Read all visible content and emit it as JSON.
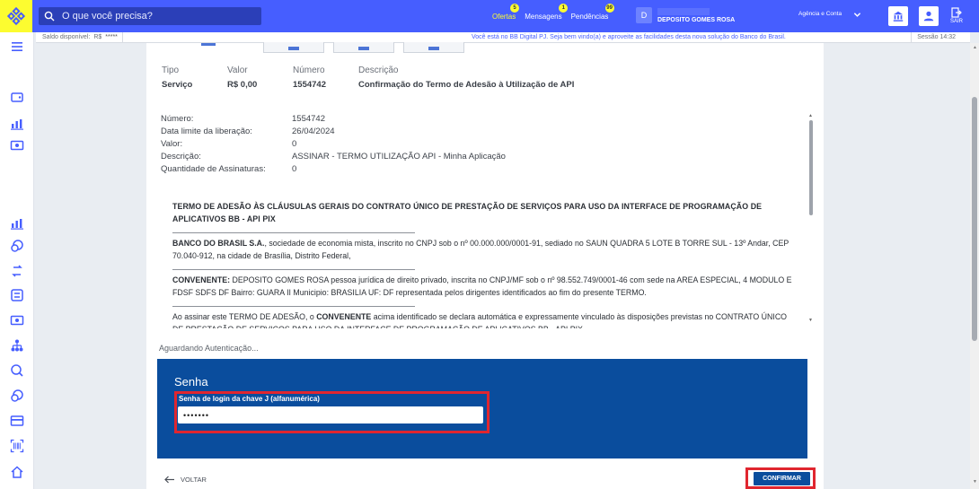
{
  "topbar": {
    "search_placeholder": "O que você precisa?",
    "nav": [
      {
        "label": "Ofertas",
        "badge": "5"
      },
      {
        "label": "Mensagens",
        "badge": "1"
      },
      {
        "label": "Pendências",
        "badge": "99"
      }
    ],
    "avatar_initial": "D",
    "company_name": "DEPOSITO GOMES ROSA",
    "agency_label": "Agência e Conta",
    "logout_label": "SAIR"
  },
  "infobar": {
    "balance_label": "Saldo disponível:",
    "balance_currency": "R$",
    "balance_value": "*****",
    "welcome": "Você está no BB Digital PJ. Seja bem vindo(a) e aproveite as facilidades desta nova solução do Banco do Brasil.",
    "session": "Sessão 14:32"
  },
  "summary": {
    "headers": [
      "Tipo",
      "Valor",
      "Número",
      "Descrição"
    ],
    "values": [
      "Serviço",
      "R$ 0,00",
      "1554742",
      "Confirmação do Termo de Adesão à Utilização de API"
    ]
  },
  "details": [
    {
      "label": "Número:",
      "value": "1554742"
    },
    {
      "label": "Data limite da liberação:",
      "value": "26/04/2024"
    },
    {
      "label": "Valor:",
      "value": "0"
    },
    {
      "label": "Descrição:",
      "value": "ASSINAR - TERMO UTILIZAÇÃO API - Minha Aplicação"
    },
    {
      "label": "Quantidade de Assinaturas:",
      "value": "0"
    }
  ],
  "term": {
    "title": "TERMO DE ADESÃO ÀS CLÁUSULAS GERAIS DO CONTRATO ÚNICO DE PRESTAÇÃO DE SERVIÇOS PARA USO DA INTERFACE DE PROGRAMAÇÃO DE APLICATIVOS BB - API PIX",
    "bank_name": "BANCO DO BRASIL S.A.",
    "bank_text": ", sociedade de economia mista, inscrito no CNPJ sob o nº 00.000.000/0001-91, sediado no SAUN QUADRA 5 LOTE B TORRE SUL - 13º Andar, CEP 70.040-912, na cidade de Brasília, Distrito Federal,",
    "conv_label": "CONVENENTE:",
    "conv_text": " DEPOSITO GOMES ROSA pessoa jurídica de direito privado, inscrita no CNPJ/MF sob o nº 98.552.749/0001-46 com sede na AREA ESPECIAL, 4 MODULO E FDSF SDFS DF Bairro: GUARA II Municipio: BRASILIA UF: DF representada pelos dirigentes identificados ao fim do presente TERMO.",
    "adhesion_pre": "Ao assinar este TERMO DE ADESÃO, o ",
    "adhesion_bold": "CONVENENTE",
    "adhesion_post": " acima identificado se declara automática e expressamente vinculado às disposições previstas no CONTRATO ÚNICO DE PRESTAÇÃO DE SERVIÇOS PARA USO DA INTERFACE DE PROGRAMAÇÃO DE APLICATIVOS BB - API PIX"
  },
  "waiting": "Aguardando Autenticação...",
  "password": {
    "title": "Senha",
    "label": "Senha de login da chave J (alfanumérica)",
    "value": "•••••••"
  },
  "actions": {
    "back": "VOLTAR",
    "confirm": "CONFIRMAR"
  }
}
